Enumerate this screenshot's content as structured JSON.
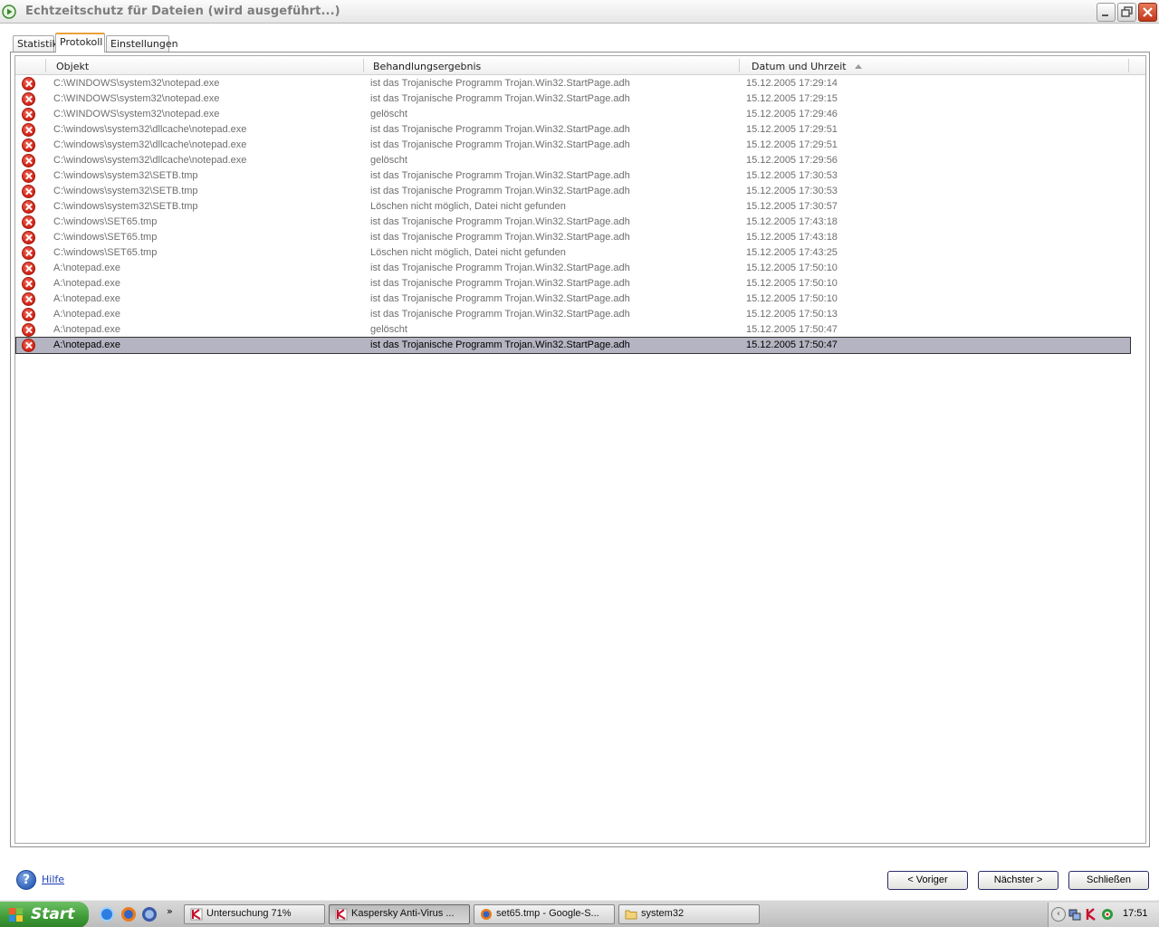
{
  "window": {
    "title": "Echtzeitschutz für Dateien (wird ausgeführt...)",
    "accent_color": "#e8a23a"
  },
  "tabs": [
    {
      "label": "Statistik",
      "active": false
    },
    {
      "label": "Protokoll",
      "active": true
    },
    {
      "label": "Einstellungen",
      "active": false
    }
  ],
  "table": {
    "columns": [
      "Objekt",
      "Behandlungsergebnis",
      "Datum und Uhrzeit"
    ],
    "sorted_column": "Datum und Uhrzeit",
    "sort_direction": "ascending",
    "status_icon": "error-x-icon",
    "rows": [
      {
        "objekt": "C:\\WINDOWS\\system32\\notepad.exe",
        "ergebnis": "ist das Trojanische Programm Trojan.Win32.StartPage.adh",
        "datum": "15.12.2005 17:29:14"
      },
      {
        "objekt": "C:\\WINDOWS\\system32\\notepad.exe",
        "ergebnis": "ist das Trojanische Programm Trojan.Win32.StartPage.adh",
        "datum": "15.12.2005 17:29:15"
      },
      {
        "objekt": "C:\\WINDOWS\\system32\\notepad.exe",
        "ergebnis": "gelöscht",
        "datum": "15.12.2005 17:29:46"
      },
      {
        "objekt": "C:\\windows\\system32\\dllcache\\notepad.exe",
        "ergebnis": "ist das Trojanische Programm Trojan.Win32.StartPage.adh",
        "datum": "15.12.2005 17:29:51"
      },
      {
        "objekt": "C:\\windows\\system32\\dllcache\\notepad.exe",
        "ergebnis": "ist das Trojanische Programm Trojan.Win32.StartPage.adh",
        "datum": "15.12.2005 17:29:51"
      },
      {
        "objekt": "C:\\windows\\system32\\dllcache\\notepad.exe",
        "ergebnis": "gelöscht",
        "datum": "15.12.2005 17:29:56"
      },
      {
        "objekt": "C:\\windows\\system32\\SETB.tmp",
        "ergebnis": "ist das Trojanische Programm Trojan.Win32.StartPage.adh",
        "datum": "15.12.2005 17:30:53"
      },
      {
        "objekt": "C:\\windows\\system32\\SETB.tmp",
        "ergebnis": "ist das Trojanische Programm Trojan.Win32.StartPage.adh",
        "datum": "15.12.2005 17:30:53"
      },
      {
        "objekt": "C:\\windows\\system32\\SETB.tmp",
        "ergebnis": "Löschen nicht möglich, Datei nicht gefunden",
        "datum": "15.12.2005 17:30:57"
      },
      {
        "objekt": "C:\\windows\\SET65.tmp",
        "ergebnis": "ist das Trojanische Programm Trojan.Win32.StartPage.adh",
        "datum": "15.12.2005 17:43:18"
      },
      {
        "objekt": "C:\\windows\\SET65.tmp",
        "ergebnis": "ist das Trojanische Programm Trojan.Win32.StartPage.adh",
        "datum": "15.12.2005 17:43:18"
      },
      {
        "objekt": "C:\\windows\\SET65.tmp",
        "ergebnis": "Löschen nicht möglich, Datei nicht gefunden",
        "datum": "15.12.2005 17:43:25"
      },
      {
        "objekt": "A:\\notepad.exe",
        "ergebnis": "ist das Trojanische Programm Trojan.Win32.StartPage.adh",
        "datum": "15.12.2005 17:50:10"
      },
      {
        "objekt": "A:\\notepad.exe",
        "ergebnis": "ist das Trojanische Programm Trojan.Win32.StartPage.adh",
        "datum": "15.12.2005 17:50:10"
      },
      {
        "objekt": "A:\\notepad.exe",
        "ergebnis": "ist das Trojanische Programm Trojan.Win32.StartPage.adh",
        "datum": "15.12.2005 17:50:10"
      },
      {
        "objekt": "A:\\notepad.exe",
        "ergebnis": "ist das Trojanische Programm Trojan.Win32.StartPage.adh",
        "datum": "15.12.2005 17:50:13"
      },
      {
        "objekt": "A:\\notepad.exe",
        "ergebnis": "gelöscht",
        "datum": "15.12.2005 17:50:47"
      },
      {
        "objekt": "A:\\notepad.exe",
        "ergebnis": "ist das Trojanische Programm Trojan.Win32.StartPage.adh",
        "datum": "15.12.2005 17:50:47",
        "selected": true
      }
    ]
  },
  "footer": {
    "help_label": "Hilfe",
    "prev_label": "< Vorig‌er",
    "next_label": "Nächster >",
    "close_label": "Schließen"
  },
  "taskbar": {
    "start_label": "Start",
    "quicklaunch_more": "»",
    "tasks": [
      {
        "label": "Untersuchung 71%",
        "icon": "kaspersky-icon",
        "active": false
      },
      {
        "label": "Kaspersky Anti-Virus ...",
        "icon": "kaspersky-icon",
        "active": true
      },
      {
        "label": "set65.tmp - Google-S...",
        "icon": "firefox-icon",
        "active": false
      },
      {
        "label": "system32",
        "icon": "folder-icon",
        "active": false
      }
    ],
    "tray_expand": "‹",
    "clock": "17:51"
  }
}
